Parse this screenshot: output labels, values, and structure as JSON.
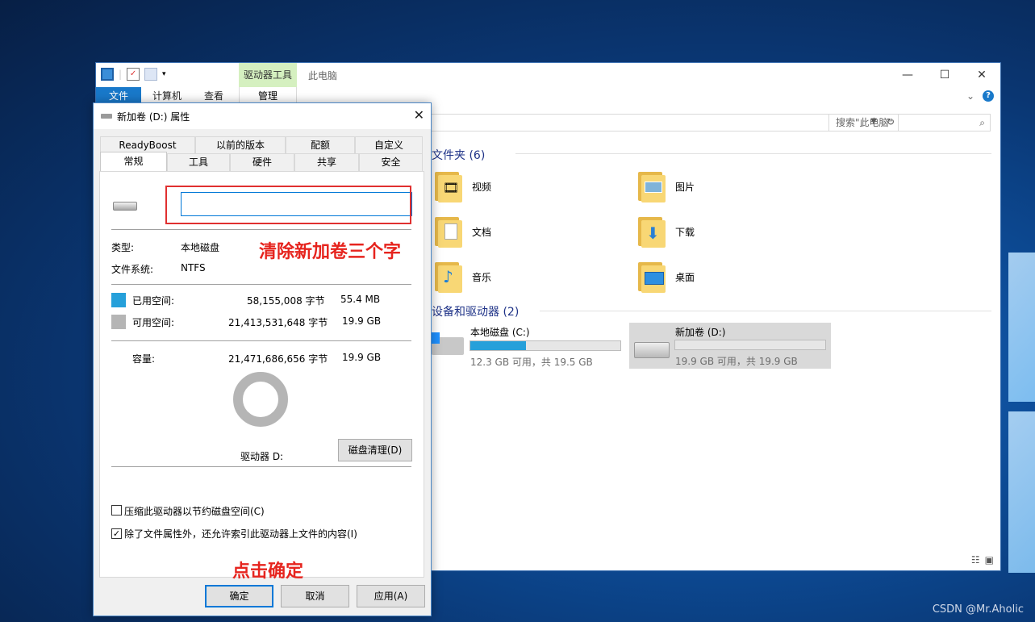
{
  "explorer": {
    "title": "此电脑",
    "context_tab": "驱动器工具",
    "context_sub_tab": "管理",
    "ribbon_tabs": [
      "文件",
      "计算机",
      "查看"
    ],
    "search_placeholder": "搜索\"此电脑\"",
    "folders_heading": "文件夹 (6)",
    "folders": [
      {
        "name": "视频",
        "icon": "video-folder-icon"
      },
      {
        "name": "图片",
        "icon": "pictures-folder-icon"
      },
      {
        "name": "文档",
        "icon": "documents-folder-icon"
      },
      {
        "name": "下载",
        "icon": "downloads-folder-icon"
      },
      {
        "name": "音乐",
        "icon": "music-folder-icon"
      },
      {
        "name": "桌面",
        "icon": "desktop-folder-icon"
      }
    ],
    "devices_heading": "设备和驱动器 (2)",
    "drives": [
      {
        "name": "本地磁盘 (C:)",
        "detail": "12.3 GB 可用，共 19.5 GB",
        "used_fraction": 0.37
      },
      {
        "name": "新加卷 (D:)",
        "detail": "19.9 GB 可用，共 19.9 GB",
        "used_fraction": 0.0
      }
    ]
  },
  "dialog": {
    "title": "新加卷 (D:) 属性",
    "tabs_row1": [
      "ReadyBoost",
      "以前的版本",
      "配额",
      "自定义"
    ],
    "tabs_row2": [
      "常规",
      "工具",
      "硬件",
      "共享",
      "安全"
    ],
    "volume_name_value": "",
    "type_label": "类型:",
    "type_value": "本地磁盘",
    "fs_label": "文件系统:",
    "fs_value": "NTFS",
    "used_label": "已用空间:",
    "used_bytes": "58,155,008 字节",
    "used_human": "55.4 MB",
    "free_label": "可用空间:",
    "free_bytes": "21,413,531,648 字节",
    "free_human": "19.9 GB",
    "capacity_label": "容量:",
    "capacity_bytes": "21,471,686,656 字节",
    "capacity_human": "19.9 GB",
    "used_color": "#26a0da",
    "free_color": "#b5b5b5",
    "drive_label": "驱动器 D:",
    "cleanup_button": "磁盘清理(D)",
    "compress_label": "压缩此驱动器以节约磁盘空间(C)",
    "compress_checked": false,
    "index_label": "除了文件属性外，还允许索引此驱动器上文件的内容(I)",
    "index_checked": true,
    "ok_button": "确定",
    "cancel_button": "取消",
    "apply_button": "应用(A)"
  },
  "annotations": {
    "clear_text": "清除新加卷三个字",
    "click_ok": "点击确定"
  },
  "watermark": "CSDN @Mr.Aholic"
}
